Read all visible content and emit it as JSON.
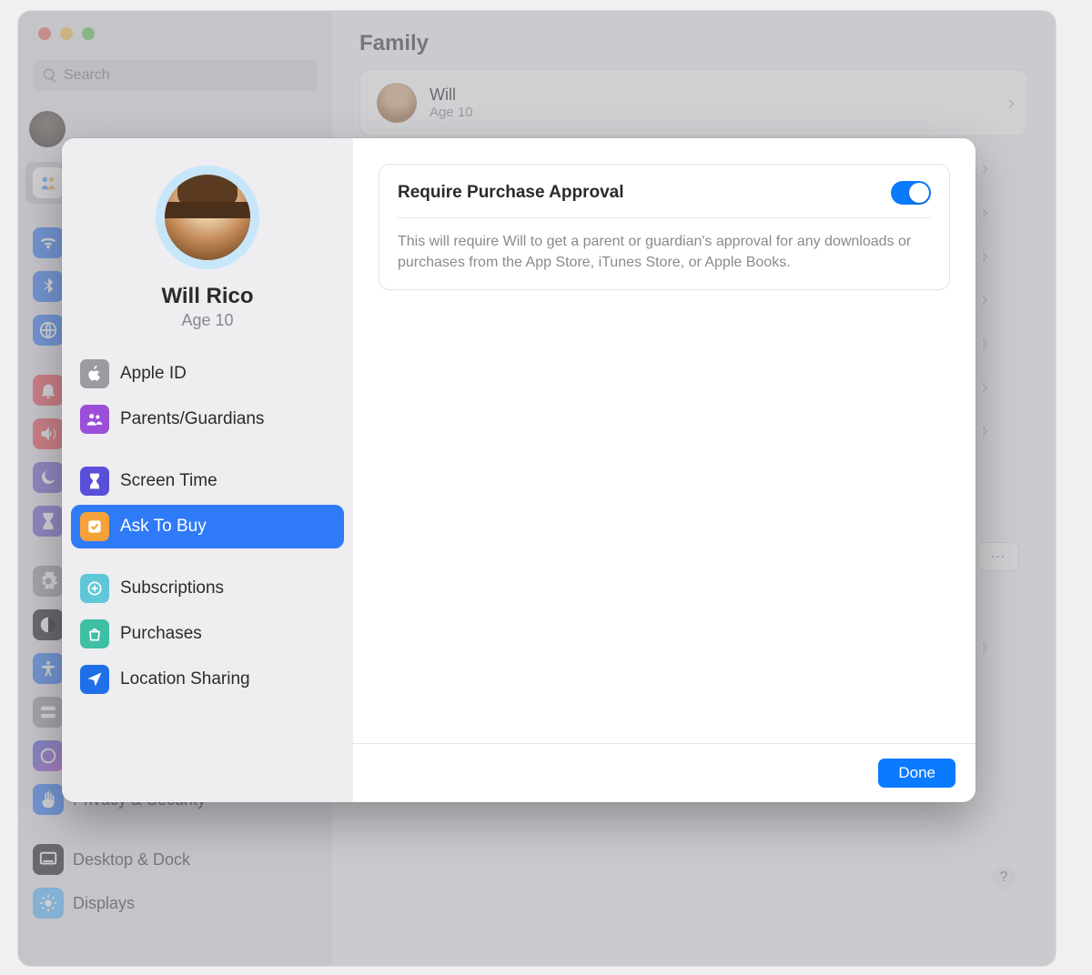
{
  "window": {
    "search_placeholder": "Search",
    "main_title": "Family"
  },
  "member_card": {
    "name": "Will",
    "age": "Age 10"
  },
  "background_sidebar": {
    "items": [
      {
        "label": "Privacy & Security"
      },
      {
        "label": "Desktop & Dock"
      },
      {
        "label": "Displays"
      }
    ]
  },
  "help_label": "?",
  "more_label": "⋯",
  "sheet": {
    "profile": {
      "name": "Will Rico",
      "age": "Age 10"
    },
    "nav": [
      {
        "id": "apple-id",
        "label": "Apple ID",
        "color": "#9b9ba0",
        "icon": "apple"
      },
      {
        "id": "parents",
        "label": "Parents/Guardians",
        "color": "#9b4fd9",
        "icon": "people"
      },
      {
        "id": "screen-time",
        "label": "Screen Time",
        "color": "#5a4fd9",
        "icon": "hourglass"
      },
      {
        "id": "ask-to-buy",
        "label": "Ask To Buy",
        "color": "#f7a13a",
        "icon": "badge-check",
        "selected": true
      },
      {
        "id": "subscriptions",
        "label": "Subscriptions",
        "color": "#5fc8d8",
        "icon": "plus-circle"
      },
      {
        "id": "purchases",
        "label": "Purchases",
        "color": "#3fbfa4",
        "icon": "bag"
      },
      {
        "id": "location",
        "label": "Location Sharing",
        "color": "#1e6fe8",
        "icon": "location"
      }
    ],
    "setting": {
      "title": "Require Purchase Approval",
      "enabled": true,
      "description": "This will require Will to get a parent or guardian's approval for any downloads or purchases from the App Store, iTunes Store, or Apple Books."
    },
    "done_label": "Done"
  },
  "bg_icons_colors": {
    "wifi": "#2f7af7",
    "bt": "#2f7af7",
    "net": "#2f7af7",
    "notif": "#ed4956",
    "sound": "#ed4956",
    "focus": "#715bd1",
    "st": "#715bd1",
    "gen": "#9b9ba0",
    "appear": "#1c1c1e",
    "acc": "#2f7af7",
    "cc": "#9b9ba0",
    "siri": "linear-gradient(135deg,#3b5bd4,#b84bd1)",
    "privacy": "#2f7af7",
    "desk": "#1c1c1e",
    "disp": "#56b8ff"
  }
}
